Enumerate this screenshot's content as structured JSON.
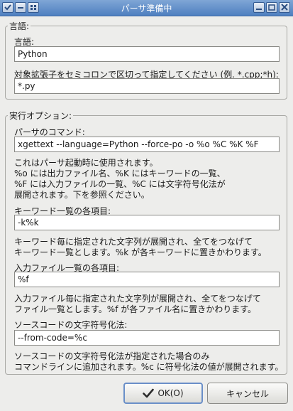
{
  "window": {
    "title": "パーサ準備中"
  },
  "language_group": {
    "legend": "言語:",
    "language_label": "言語:",
    "language_value": "Python",
    "ext_label": "対象拡張子をセミコロンで区切って指定してください (例. *.cpp;*h):",
    "ext_value": "*.py"
  },
  "options_group": {
    "legend": "実行オプション:",
    "command_label": "パーサのコマンド:",
    "command_value": "xgettext --language=Python --force-po -o %o %C %K %F",
    "command_desc": "これはパーサ起動時に使用されます。\n%o には出力ファイル名、%K にはキーワードの一覧、\n%F には入力ファイルの一覧、%C には文字符号化法が\n展開されます。下を参照ください。",
    "keyword_label": "キーワード一覧の各項目:",
    "keyword_value": "-k%k",
    "keyword_desc": "キーワード毎に指定された文字列が展開され、全てをつなげて\nキーワード一覧とします。%k が各キーワードに置きかわります。",
    "file_label": "入力ファイル一覧の各項目:",
    "file_value": "%f",
    "file_desc": "入力ファイル毎に指定された文字列が展開され、全てをつなげて\nファイル一覧とします。%f が各ファイル名に置きかわります。",
    "charset_label": "ソースコードの文字符号化法:",
    "charset_value": "--from-code=%c",
    "charset_desc": "ソースコードの文字符号化法が指定された場合のみ\nコマンドラインに追加されます。%c に符号化法の値が展開されます。"
  },
  "buttons": {
    "ok": "OK(O)",
    "cancel": "キャンセル"
  }
}
